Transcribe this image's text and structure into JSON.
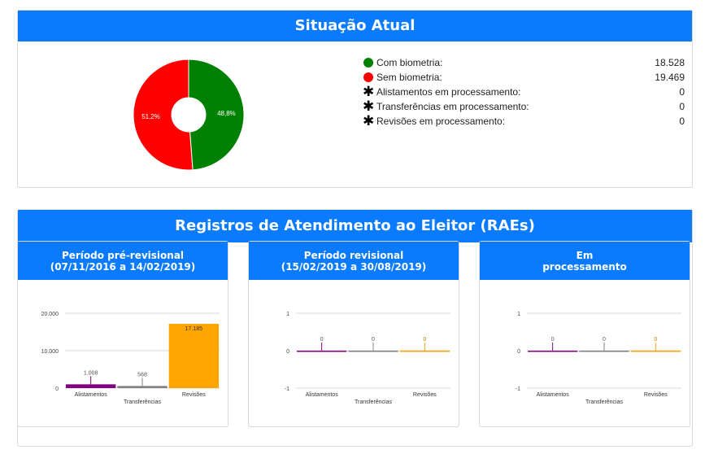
{
  "situacao": {
    "title": "Situação Atual",
    "pie": {
      "slices": [
        {
          "name": "Sem biometria",
          "percent_label": "51,2%",
          "value": 51.2,
          "color": "#ff0000"
        },
        {
          "name": "Com biometria",
          "percent_label": "48,8%",
          "value": 48.8,
          "color": "#008000"
        }
      ]
    },
    "legend": [
      {
        "marker": "circle",
        "color": "#008000",
        "label": "Com biometria:",
        "value": "18.528"
      },
      {
        "marker": "circle",
        "color": "#ff0000",
        "label": "Sem biometria:",
        "value": "19.469"
      },
      {
        "marker": "asterisk-icon",
        "label": "Alistamentos em processamento:",
        "value": "0"
      },
      {
        "marker": "asterisk-icon",
        "label": "Transferências em processamento:",
        "value": "0"
      },
      {
        "marker": "asterisk-icon",
        "label": "Revisões em processamento:",
        "value": "0"
      }
    ]
  },
  "raes": {
    "title": "Registros de Atendimento ao Eleitor (RAEs)",
    "panels": [
      {
        "title_line1": "Período pré-revisional",
        "title_line2": "(07/11/2016 a 14/02/2019)"
      },
      {
        "title_line1": "Período revisional",
        "title_line2": "(15/02/2019 a 30/08/2019)"
      },
      {
        "title_line1": "Em",
        "title_line2": "processamento"
      }
    ]
  },
  "chart_data": [
    {
      "type": "pie",
      "title": "",
      "categories": [
        "Sem biometria",
        "Com biometria"
      ],
      "values": [
        51.2,
        48.8
      ],
      "labels": [
        "51,2%",
        "48,8%"
      ],
      "colors": [
        "#ff0000",
        "#008000"
      ],
      "donut": true
    },
    {
      "type": "bar",
      "title": "",
      "categories": [
        "Alistamentos",
        "Transferências",
        "Revisões"
      ],
      "values": [
        1008,
        568,
        17185
      ],
      "value_labels": [
        "1.008",
        "568",
        "17.185"
      ],
      "colors": [
        "#800080",
        "#808080",
        "#ffa500"
      ],
      "ylim": [
        0,
        20000
      ],
      "yticks": [
        0,
        10000,
        20000
      ],
      "ytick_labels": [
        "0",
        "10.000",
        "20.000"
      ],
      "grid": true,
      "xlabel": "",
      "ylabel": ""
    },
    {
      "type": "bar",
      "title": "",
      "categories": [
        "Alistamentos",
        "Transferências",
        "Revisões"
      ],
      "values": [
        0,
        0,
        0
      ],
      "value_labels": [
        "0",
        "0",
        "0"
      ],
      "colors": [
        "#800080",
        "#808080",
        "#ffa500"
      ],
      "ylim": [
        -1,
        1
      ],
      "yticks": [
        -1,
        0,
        1
      ],
      "ytick_labels": [
        "-1",
        "0",
        "1"
      ],
      "grid": true,
      "xlabel": "",
      "ylabel": ""
    },
    {
      "type": "bar",
      "title": "",
      "categories": [
        "Alistamentos",
        "Transferências",
        "Revisões"
      ],
      "values": [
        0,
        0,
        0
      ],
      "value_labels": [
        "0",
        "0",
        "0"
      ],
      "colors": [
        "#800080",
        "#808080",
        "#ffa500"
      ],
      "ylim": [
        -1,
        1
      ],
      "yticks": [
        -1,
        0,
        1
      ],
      "ytick_labels": [
        "-1",
        "0",
        "1"
      ],
      "grid": true,
      "xlabel": "",
      "ylabel": ""
    }
  ]
}
